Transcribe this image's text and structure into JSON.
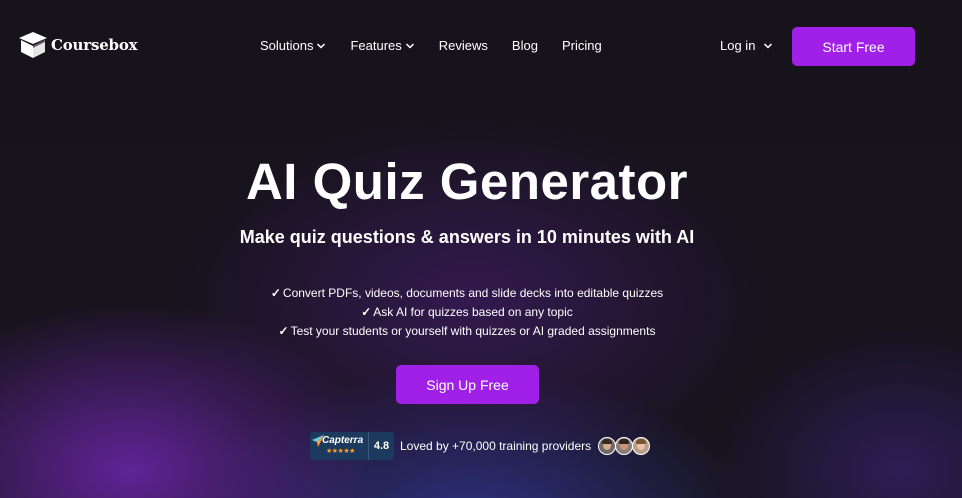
{
  "brand": {
    "name": "Coursebox",
    "logo_icon": "graduation-cap-icon"
  },
  "nav": {
    "items": [
      {
        "label": "Solutions",
        "dropdown": true
      },
      {
        "label": "Features",
        "dropdown": true
      },
      {
        "label": "Reviews",
        "dropdown": false
      },
      {
        "label": "Blog",
        "dropdown": false
      },
      {
        "label": "Pricing",
        "dropdown": false
      }
    ],
    "login_label": "Log in",
    "cta_label": "Start Free"
  },
  "hero": {
    "title": "AI Quiz Generator",
    "subtitle": "Make quiz questions & answers in 10 minutes with AI",
    "features": [
      "Convert PDFs, videos, documents and slide decks into editable quizzes",
      "Ask AI for quizzes based on any topic",
      "Test your students or yourself with quizzes or AI graded assignments"
    ],
    "check_glyph": "✓",
    "cta_label": "Sign Up Free"
  },
  "social_proof": {
    "rating_source": "Capterra",
    "stars": 5,
    "rating": "4.8",
    "text": "Loved by +70,000 training providers",
    "avatar_count": 3
  },
  "colors": {
    "accent": "#a020e8",
    "background": "#14111a",
    "capterra_bg": "#1c3a5e",
    "star": "#ff9d28"
  }
}
